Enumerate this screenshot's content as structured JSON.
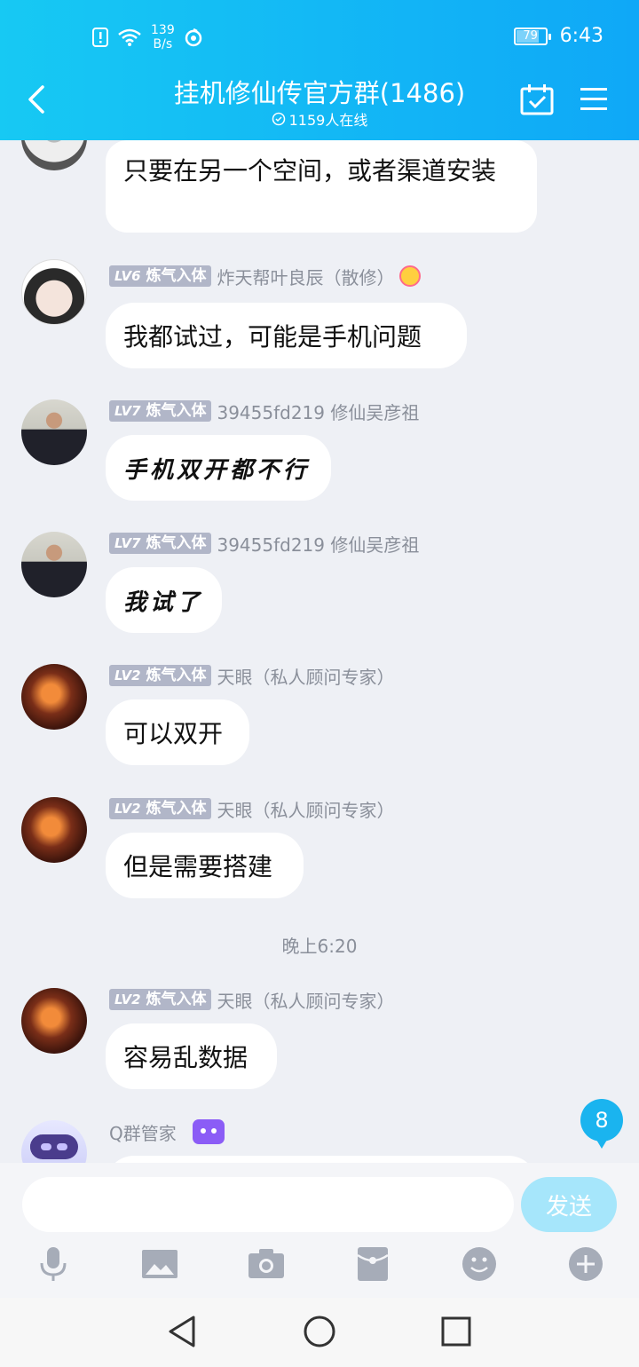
{
  "status_bar": {
    "speed_value": "139",
    "speed_unit": "B/s",
    "battery": "79",
    "time": "6:43"
  },
  "header": {
    "title": "挂机修仙传官方群(1486)",
    "online": "1159人在线"
  },
  "messages": [
    {
      "text": "只要在另一个空间，或者渠道安装"
    },
    {
      "level": "LV6",
      "rank": "炼气入体",
      "name": "炸天帮叶良辰（散修）",
      "text": "我都试过，可能是手机问题"
    },
    {
      "level": "LV7",
      "rank": "炼气入体",
      "name": "39455fd219 修仙吴彦祖",
      "text": "手机双开都不行"
    },
    {
      "level": "LV7",
      "rank": "炼气入体",
      "name": "39455fd219 修仙吴彦祖",
      "text": "我试了"
    },
    {
      "level": "LV2",
      "rank": "炼气入体",
      "name": "天眼（私人顾问专家）",
      "text": "可以双开"
    },
    {
      "level": "LV2",
      "rank": "炼气入体",
      "name": "天眼（私人顾问专家）",
      "text": "但是需要搭建"
    },
    {
      "level": "LV2",
      "rank": "炼气入体",
      "name": "天眼（私人顾问专家）",
      "text": "容易乱数据"
    },
    {
      "name": "Q群管家"
    }
  ],
  "time_separator": "晚上6:20",
  "unread_count": "8",
  "composer": {
    "value": "",
    "placeholder": "",
    "send_label": "发送"
  },
  "toolbar_icons": [
    "microphone-icon",
    "image-icon",
    "camera-icon",
    "red-packet-icon",
    "emoji-icon",
    "plus-icon"
  ],
  "nav_icons": [
    "back-triangle-icon",
    "home-circle-icon",
    "recents-square-icon"
  ],
  "colors": {
    "header_start": "#17c9f3",
    "header_end": "#0fa8f7",
    "chat_bg": "#eef0f5",
    "send_disabled": "#a6e6fb",
    "badge": "#1ab4ef"
  }
}
